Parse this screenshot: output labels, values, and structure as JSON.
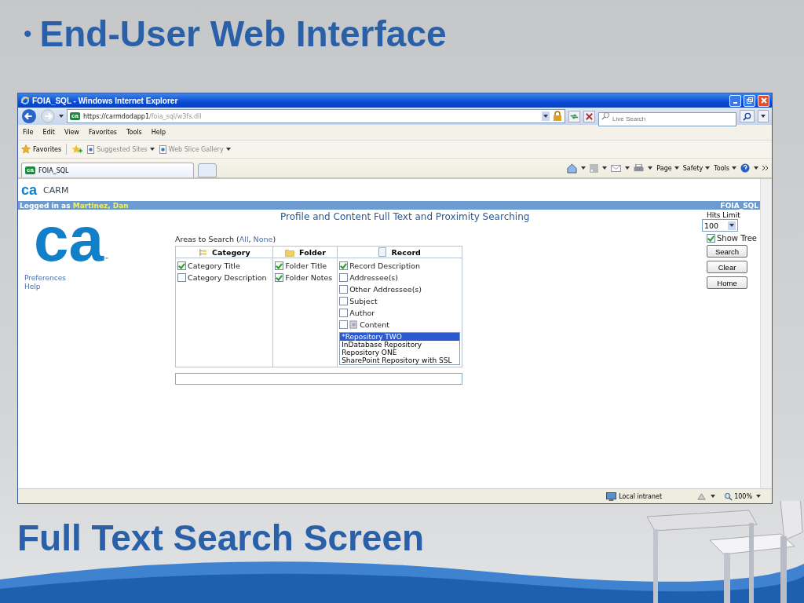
{
  "slide": {
    "bullet": "•",
    "title": "End-User Web Interface",
    "caption": "Full Text Search Screen"
  },
  "window": {
    "title": "FOIA_SQL - Windows Internet Explorer",
    "address_logo": "ca",
    "address_host": "https://carmdodapp1",
    "address_path": "/foia_sql/w3fs.dll",
    "search_placeholder": "Live Search",
    "menu": [
      "File",
      "Edit",
      "View",
      "Favorites",
      "Tools",
      "Help"
    ],
    "favorites_label": "Favorites",
    "favorites_links": [
      "Suggested Sites",
      "Web Slice Gallery"
    ],
    "tabs": [
      {
        "label": "FOIA_SQL",
        "logo": "ca",
        "selected": true
      }
    ],
    "commands": [
      "Page",
      "Safety",
      "Tools"
    ],
    "status_zone": "Local intranet",
    "status_zoom": "100%"
  },
  "page": {
    "brand_logo": "ca",
    "brand": "CARM",
    "big_logo": "ca",
    "trademark": "™",
    "login_prefix": "Logged in as",
    "user": "Martinez, Dan",
    "database": "FOIA_SQL",
    "heading": "Profile and Content Full Text and Proximity Searching",
    "side_links": [
      "Preferences",
      "Help"
    ],
    "areas": {
      "prefix": "Areas to Search (",
      "links": [
        "All",
        "None"
      ],
      "separator": ", ",
      "suffix": ")"
    },
    "columns": [
      {
        "title": "Category",
        "kind": "category",
        "items": [
          {
            "label": "Category Title",
            "checked": true
          },
          {
            "label": "Category Description",
            "checked": false
          }
        ]
      },
      {
        "title": "Folder",
        "kind": "folder",
        "items": [
          {
            "label": "Folder Title",
            "checked": true
          },
          {
            "label": "Folder Notes",
            "checked": true
          }
        ]
      },
      {
        "title": "Record",
        "kind": "record",
        "items": [
          {
            "label": "Record Description",
            "checked": true,
            "kind": "plain"
          },
          {
            "label": "Addressee(s)",
            "checked": false,
            "kind": "plain"
          },
          {
            "label": "Other Addressee(s)",
            "checked": false,
            "kind": "plain"
          },
          {
            "label": "Subject",
            "checked": false,
            "kind": "plain"
          },
          {
            "label": "Author",
            "checked": false,
            "kind": "plain"
          },
          {
            "label": "Content",
            "checked": false,
            "kind": "content"
          }
        ]
      }
    ],
    "repositories": [
      {
        "label": "*Repository TWO",
        "selected": true
      },
      {
        "label": "InDatabase Repository",
        "selected": false
      },
      {
        "label": "Repository ONE",
        "selected": false
      },
      {
        "label": "SharePoint Repository with SSL",
        "selected": false
      }
    ],
    "hits_label": "Hits Limit",
    "hits_value": "100",
    "show_tree": {
      "label": "Show Tree",
      "checked": true
    },
    "buttons": [
      "Search",
      "Clear",
      "Home"
    ]
  }
}
